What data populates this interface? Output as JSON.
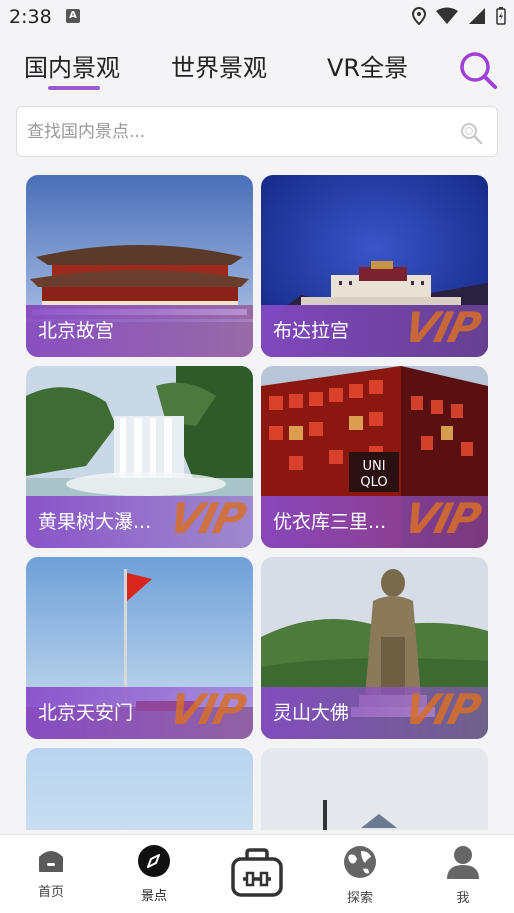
{
  "status": {
    "time": "2:38"
  },
  "tabs": [
    {
      "label": "国内景观"
    },
    {
      "label": "世界景观"
    },
    {
      "label": "VR全景"
    }
  ],
  "search": {
    "placeholder": "查找国内景点..."
  },
  "cards": [
    {
      "title": "北京故宫",
      "vip": false
    },
    {
      "title": "布达拉宫",
      "vip": true,
      "badge": "VIP"
    },
    {
      "title": "黄果树大瀑...",
      "vip": true,
      "badge": "VIP"
    },
    {
      "title": "优衣库三里...",
      "vip": true,
      "badge": "VIP"
    },
    {
      "title": "北京天安门",
      "vip": true,
      "badge": "VIP"
    },
    {
      "title": "灵山大佛",
      "vip": true,
      "badge": "VIP"
    }
  ],
  "nav": [
    {
      "label": "首页"
    },
    {
      "label": "景点"
    },
    {
      "label": "探索"
    },
    {
      "label": "我"
    }
  ],
  "colors": {
    "accent": "#9b59d0",
    "vip": "#d86e28"
  }
}
